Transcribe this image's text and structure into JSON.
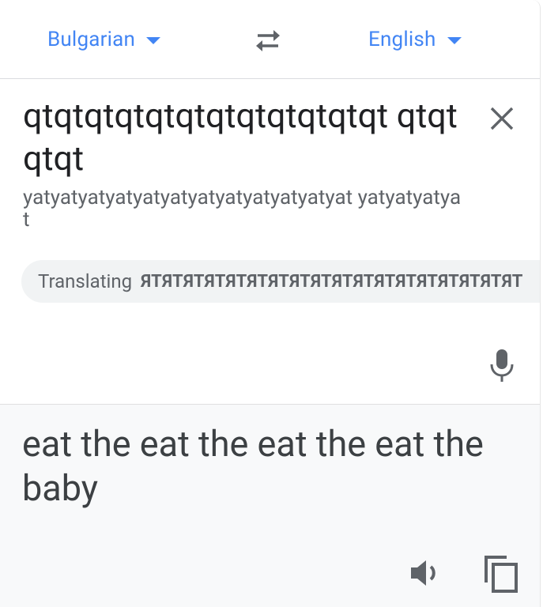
{
  "languages": {
    "source": "Bulgarian",
    "target": "English"
  },
  "source": {
    "text": "qtqtqtqtqtqtqtqtqtqtqtqt qtqtqtqt",
    "transliteration": "yatyatyatyatyatyatyatyatyatyatyatyat yatyatyatyat"
  },
  "suggestion": {
    "prefix": "Translating",
    "text": "ЯТЯТЯТЯТЯТЯТЯТЯТЯТЯТЯТЯТЯТЯТЯТЯТЯТЯТ",
    "action": "UN"
  },
  "result": {
    "text": "eat the eat the eat the eat the baby"
  },
  "colors": {
    "accent": "#4285f4",
    "text": "#202124",
    "muted": "#5f6368",
    "icon": "#5f6368"
  },
  "icons": {
    "caret": "caret-down-icon",
    "swap": "swap-arrows-icon",
    "close": "close-icon",
    "mic": "microphone-icon",
    "speaker": "speaker-icon",
    "copy": "copy-icon"
  }
}
